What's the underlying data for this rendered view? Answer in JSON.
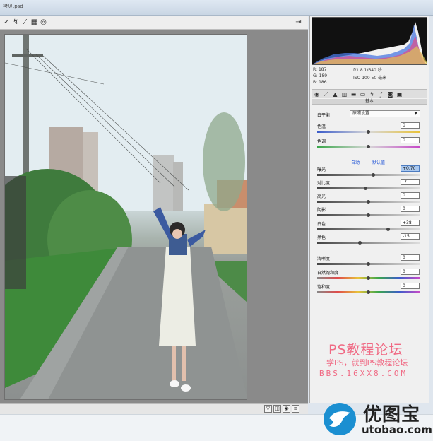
{
  "window": {
    "title": "拷贝.psd"
  },
  "toolbar": {
    "tools": [
      {
        "icon": "white-balance-tool-icon",
        "glyph": "✓"
      },
      {
        "icon": "targeted-adjust-icon",
        "glyph": "↯"
      },
      {
        "icon": "brush-icon",
        "glyph": "⁄"
      },
      {
        "icon": "stamp-icon",
        "glyph": "▦"
      },
      {
        "icon": "rotate-icon",
        "glyph": "◎"
      }
    ],
    "right_icon_glyph": "⇥"
  },
  "panel": {
    "readout": {
      "r_label": "R:",
      "r_value": "187",
      "g_label": "G:",
      "g_value": "189",
      "b_label": "B:",
      "b_value": "186"
    },
    "camera": {
      "line1": "f/1.8   1/640 秒",
      "line2": "ISO 100   50 毫米"
    },
    "section_title": "基本",
    "white_balance": {
      "label": "白平衡：",
      "value": "原照设置"
    },
    "sliders": [
      {
        "key": "temp",
        "label": "色温",
        "value": "0",
        "pos": 0.5
      },
      {
        "key": "tint",
        "label": "色调",
        "value": "0",
        "pos": 0.5
      },
      {
        "key": "exposure",
        "label": "曝光",
        "value": "+0.70",
        "pos": 0.55
      },
      {
        "key": "contrast",
        "label": "对比度",
        "value": "-7",
        "pos": 0.47
      },
      {
        "key": "highlights",
        "label": "高光",
        "value": "0",
        "pos": 0.5
      },
      {
        "key": "shadows",
        "label": "阴影",
        "value": "0",
        "pos": 0.5
      },
      {
        "key": "whites",
        "label": "白色",
        "value": "+38",
        "pos": 0.69
      },
      {
        "key": "blacks",
        "label": "黑色",
        "value": "-15",
        "pos": 0.42
      },
      {
        "key": "clarity",
        "label": "清晰度",
        "value": "0",
        "pos": 0.5
      },
      {
        "key": "vibrance",
        "label": "自然饱和度",
        "value": "0",
        "pos": 0.5
      },
      {
        "key": "saturation",
        "label": "饱和度",
        "value": "0",
        "pos": 0.5
      }
    ],
    "auto_label": "自动",
    "default_label": "默认值"
  },
  "watermark": {
    "title": "PS教程论坛",
    "subtitle": "学PS，就到PS教程论坛",
    "url": "BBS.16XX8.COM"
  },
  "logo": {
    "name": "优图宝",
    "url": "utobao.com"
  },
  "colors": {
    "accent_pink": "#f06a84",
    "link_blue": "#1a4fd6",
    "logo_blue": "#1b8fd1"
  }
}
